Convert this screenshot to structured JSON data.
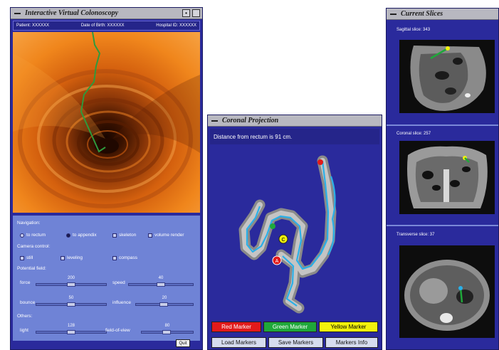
{
  "windows": {
    "virtual_colonoscopy": {
      "title": "Interactive Virtual Colonoscopy",
      "patient_label": "Patient: XXXXXX",
      "dob_label": "Date of Birth: XXXXXX",
      "hospital_label": "Hospital ID: XXXXXX",
      "navigation": {
        "label": "Navigation:",
        "to_rectum": "to rectum",
        "to_appendix": "to appendix",
        "skeleton": "skeleton",
        "volume_render": "volume render"
      },
      "camera": {
        "label": "Camera control:",
        "still": "still",
        "leveling": "leveling",
        "compass": "compass"
      },
      "potential": {
        "label": "Potential field:",
        "force_label": "force",
        "force_value": "200",
        "speed_label": "speed",
        "speed_value": "40",
        "bounce_label": "bounce",
        "bounce_value": "50",
        "influence_label": "influence",
        "influence_value": "20"
      },
      "others": {
        "label": "Others:",
        "light_label": "light",
        "light_value": "128",
        "fov_label": "field-of-view",
        "fov_value": "80"
      },
      "quit_label": "Quit"
    },
    "coronal_projection": {
      "title": "Coronal Projection",
      "distance_text": "Distance from rectum is 91 cm.",
      "red_marker": "Red Marker",
      "green_marker": "Green Marker",
      "yellow_marker": "Yellow Marker",
      "load_markers": "Load Markers",
      "save_markers": "Save Markers",
      "markers_info": "Markers Info",
      "marker_letter_a": "A",
      "marker_letter_c": "C"
    },
    "current_slices": {
      "title": "Current Slices",
      "sagittal_label": "Sagittal slice: 343",
      "coronal_label": "Coronal slice: 257",
      "transverse_label": "Transverse slice: 37"
    }
  },
  "colors": {
    "panel_blue": "#2a2a9c",
    "control_blue": "#6f83d6",
    "red_marker": "#e21a1a",
    "green_marker": "#1fa83a",
    "yellow_marker": "#f2f20c",
    "path_green": "#2f9a3c",
    "path_cyan": "#2ab0e8"
  }
}
